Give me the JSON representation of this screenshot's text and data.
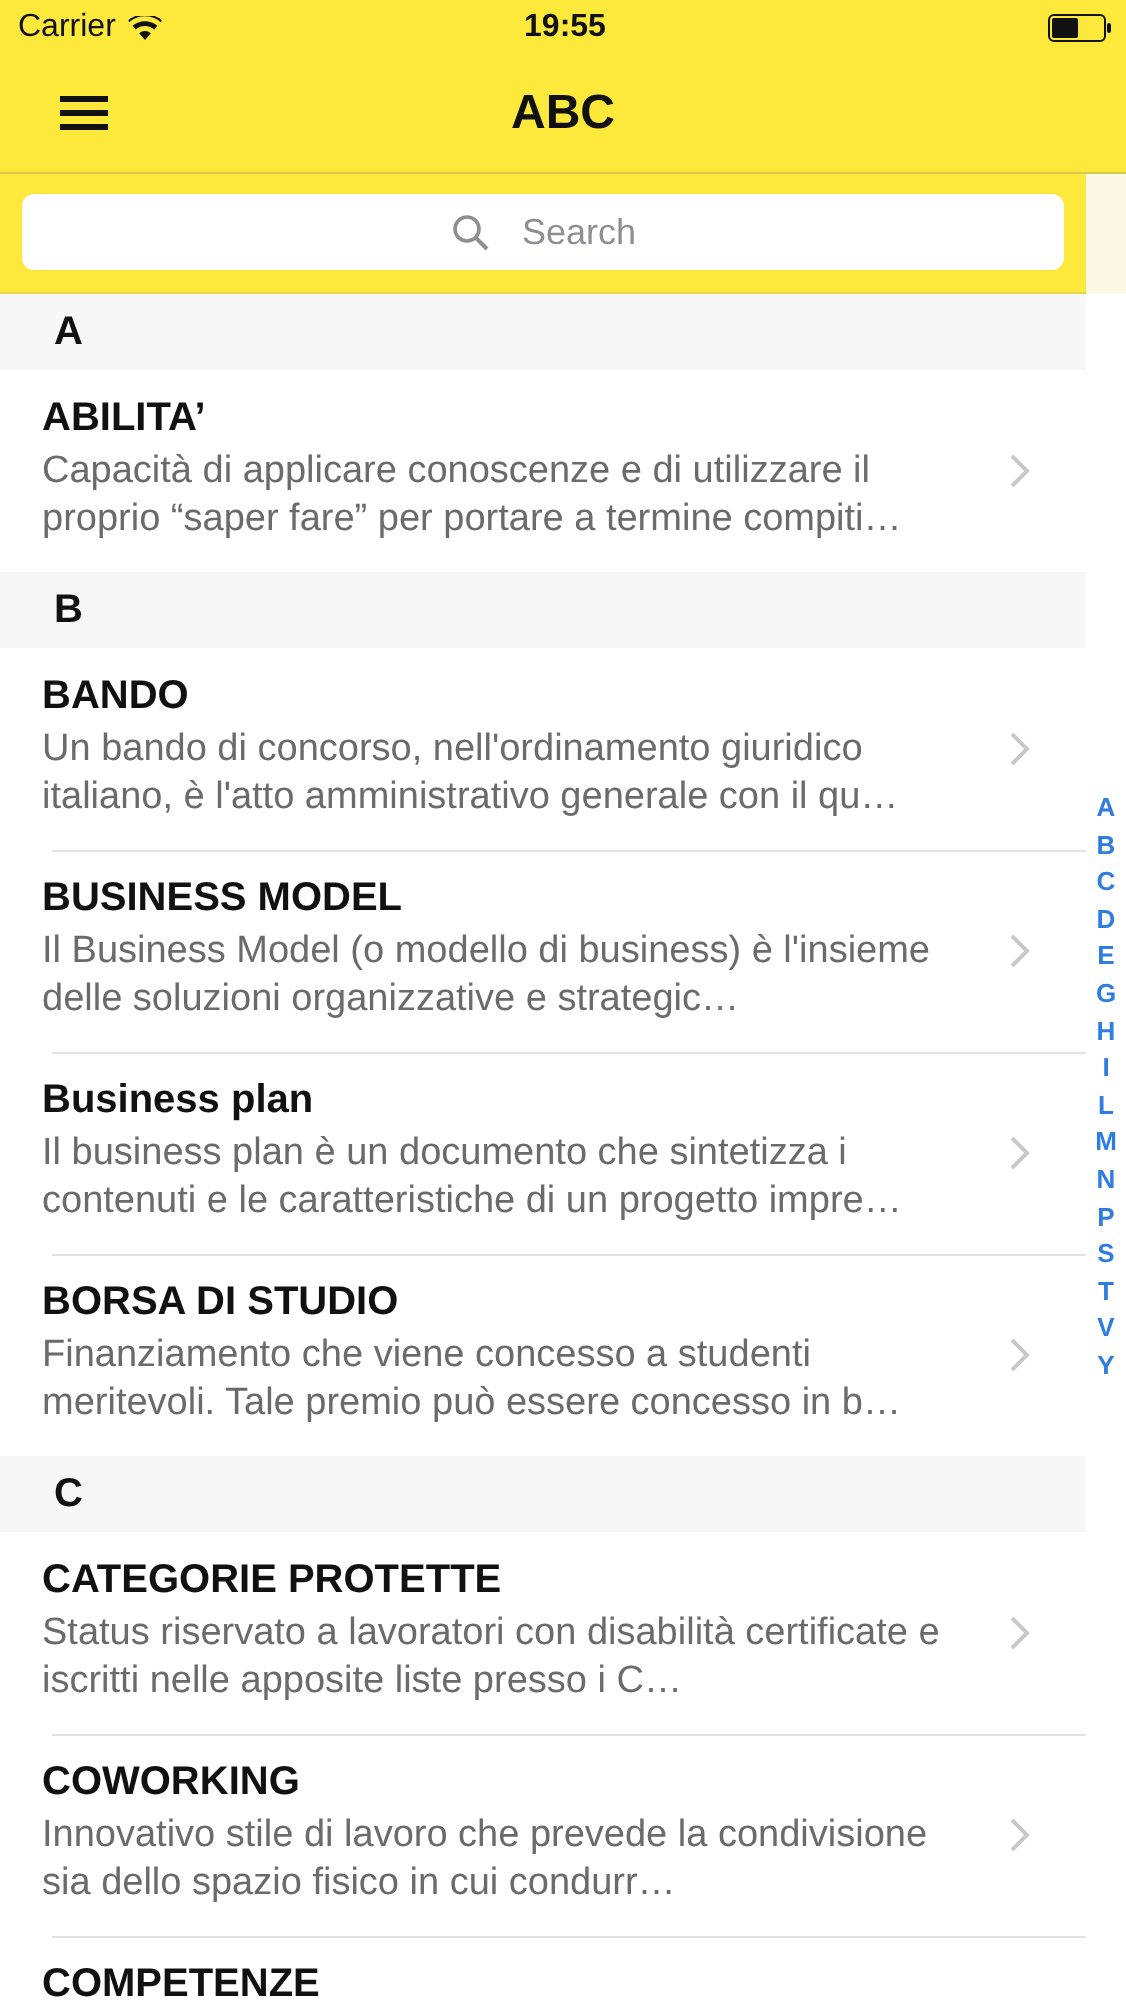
{
  "status_bar": {
    "carrier": "Carrier",
    "time": "19:55"
  },
  "nav_bar": {
    "title": "ABC"
  },
  "search": {
    "placeholder": "Search"
  },
  "sections": [
    {
      "letter": "A",
      "items": [
        {
          "title": "ABILITA’",
          "description": "Capacità di applicare conoscenze e di utilizzare il proprio “saper fare” per portare a termine compiti…"
        }
      ]
    },
    {
      "letter": "B",
      "items": [
        {
          "title": "BANDO",
          "description": "Un bando di concorso, nell'ordinamento giuridico italiano, è l'atto amministrativo generale con il qu…"
        },
        {
          "title": "BUSINESS MODEL",
          "description": "Il Business Model (o modello di business) è l'insieme delle soluzioni organizzative e strategic…"
        },
        {
          "title": "Business plan",
          "description": "Il business plan è un documento che sintetizza i contenuti e le caratteristiche di un progetto impre…"
        },
        {
          "title": "BORSA DI STUDIO",
          "description": "Finanziamento che viene concesso a studenti meritevoli. Tale premio può essere concesso in b…"
        }
      ]
    },
    {
      "letter": "C",
      "items": [
        {
          "title": "CATEGORIE PROTETTE",
          "description": "Status riservato a lavoratori con disabilità certificate e iscritti nelle apposite liste presso i C…"
        },
        {
          "title": "COWORKING",
          "description": "Innovativo stile di lavoro che prevede la condivisione sia dello spazio fisico in cui condurr…"
        },
        {
          "title": "COMPETENZE"
        }
      ]
    }
  ],
  "index": [
    "A",
    "B",
    "C",
    "D",
    "E",
    "G",
    "H",
    "I",
    "L",
    "M",
    "N",
    "P",
    "S",
    "T",
    "V",
    "Y"
  ]
}
